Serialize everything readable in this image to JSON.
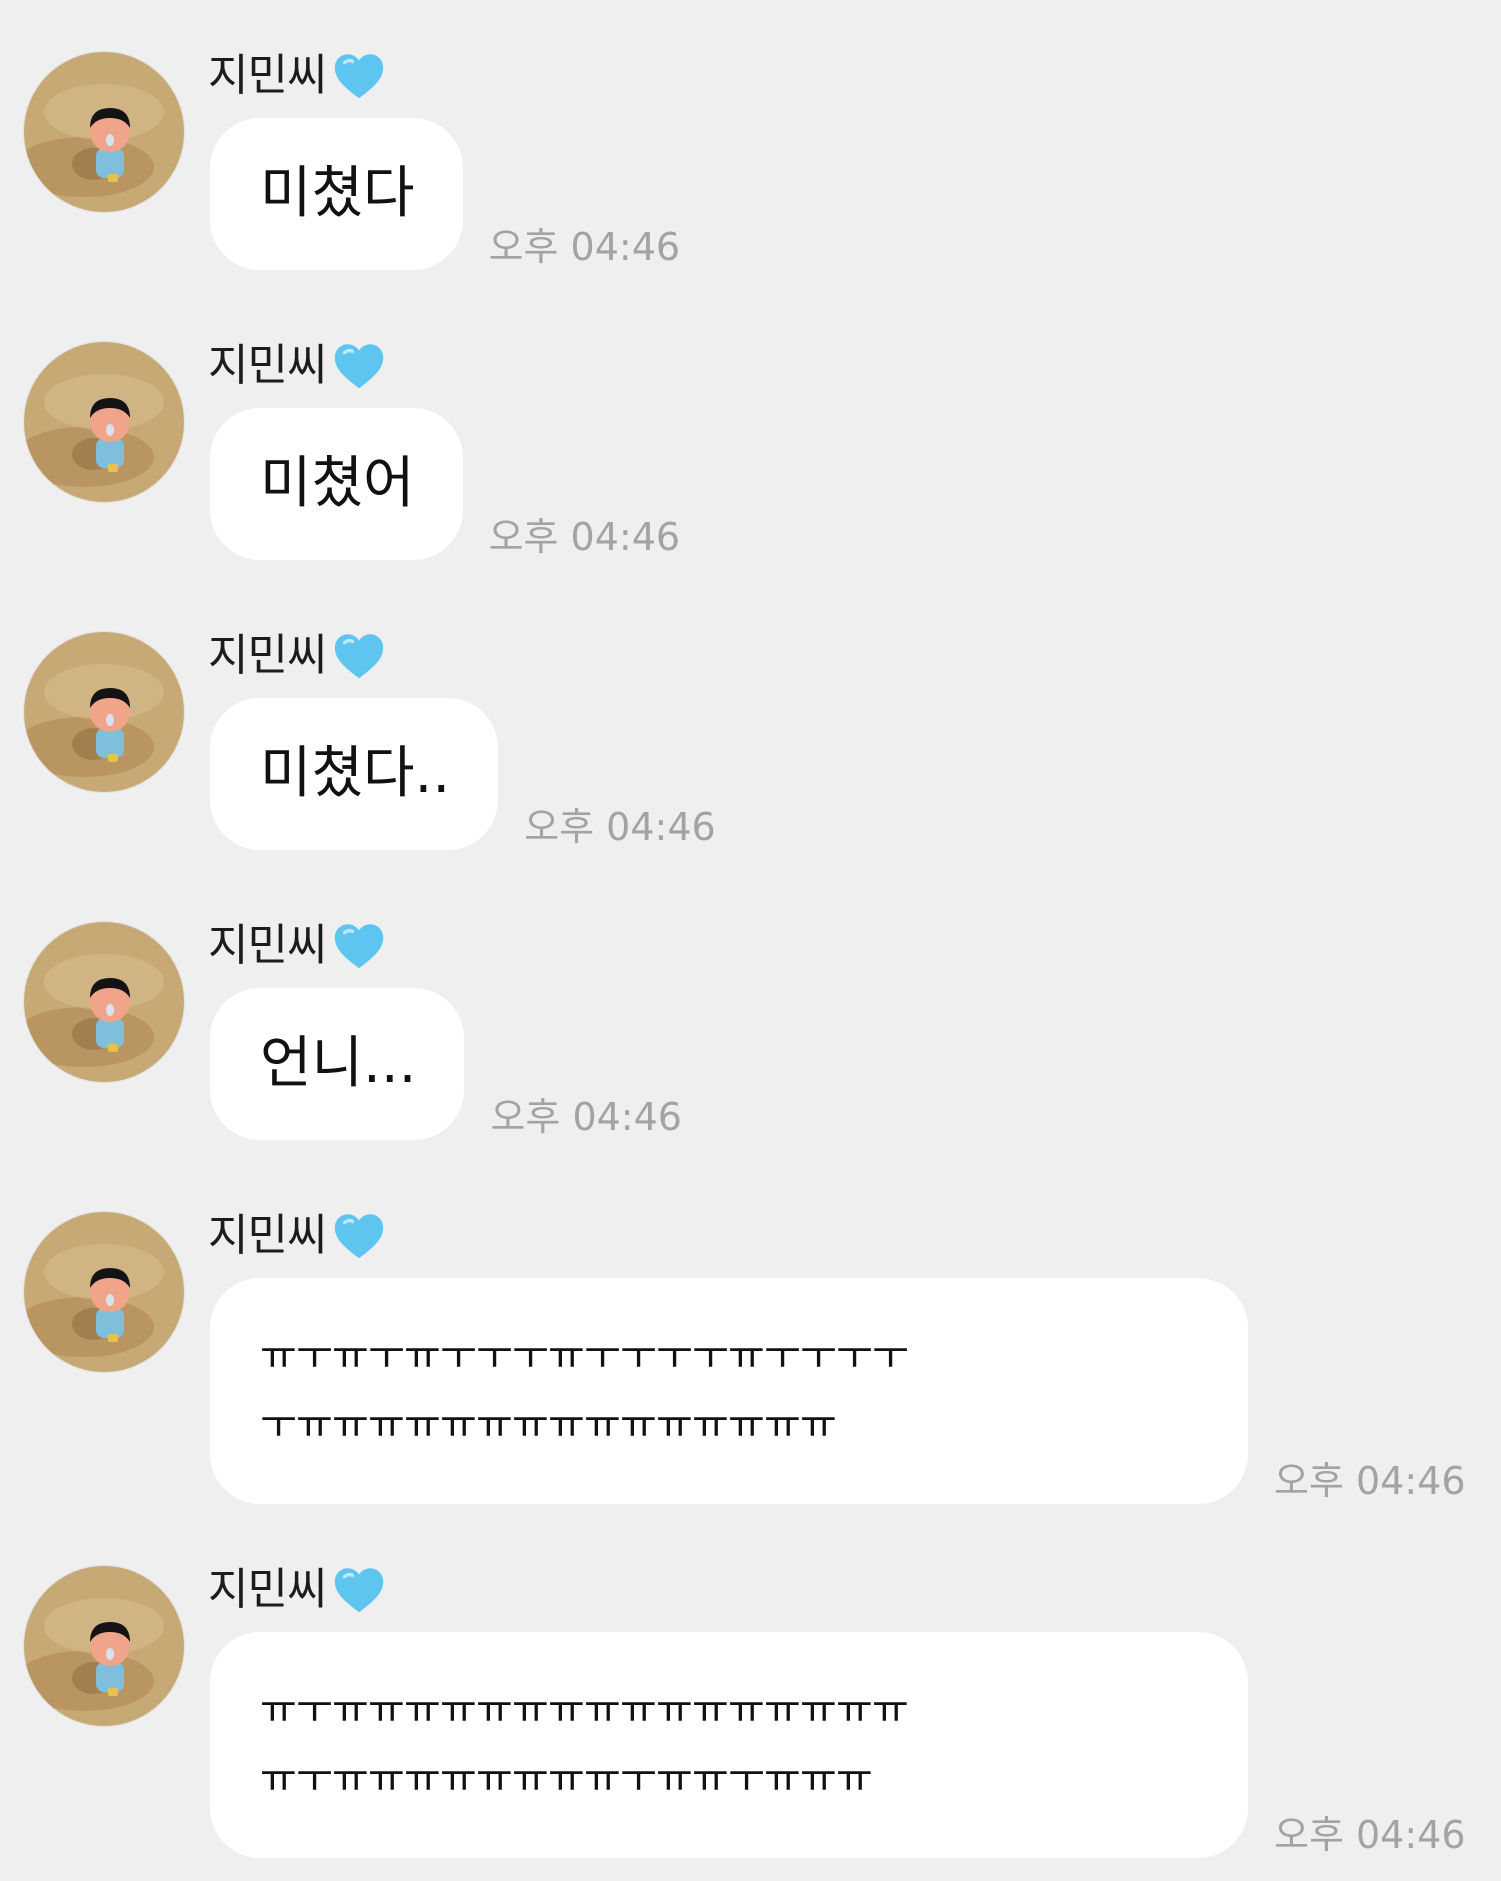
{
  "sender": {
    "name": "지민씨",
    "heart_color": "#5ec5f0"
  },
  "messages": [
    {
      "text": "미쳤다",
      "time": "오후 04:46"
    },
    {
      "text": "미쳤어",
      "time": "오후 04:46"
    },
    {
      "text": "미쳤다..",
      "time": "오후 04:46"
    },
    {
      "text": "언니...",
      "time": "오후 04:46"
    },
    {
      "text": "ㅠㅜㅠㅜㅠㅜㅜㅜㅠㅜㅜㅜㅜㅠㅜㅜㅜㅜ\nㅜㅠㅠㅠㅠㅠㅠㅠㅠㅠㅠㅠㅠㅠㅠㅠ",
      "time": "오후 04:46"
    },
    {
      "text": "ㅠㅜㅠㅠㅠㅠㅠㅠㅠㅠㅠㅠㅠㅠㅠㅠㅠㅠ\nㅠㅜㅠㅠㅠㅠㅠㅠㅠㅠㅜㅠㅠㅜㅠㅠㅠ",
      "time": "오후 04:46"
    }
  ]
}
